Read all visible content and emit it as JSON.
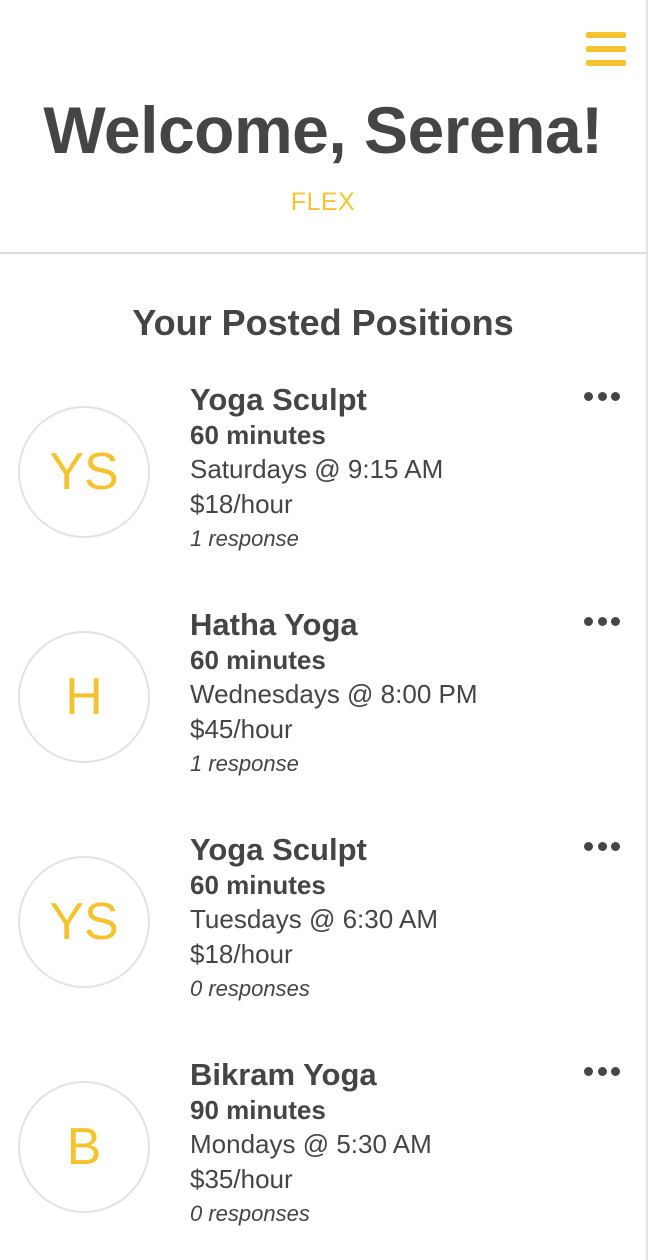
{
  "header": {
    "welcome": "Welcome, Serena!",
    "brand": "FLEX",
    "menu_icon": "hamburger-menu-icon"
  },
  "main": {
    "section_title": "Your Posted Positions",
    "positions": [
      {
        "initials": "YS",
        "title": "Yoga Sculpt",
        "duration": "60 minutes",
        "schedule": "Saturdays @ 9:15 AM",
        "rate": "$18/hour",
        "responses": "1 response"
      },
      {
        "initials": "H",
        "title": "Hatha Yoga",
        "duration": "60 minutes",
        "schedule": "Wednesdays @ 8:00 PM",
        "rate": "$45/hour",
        "responses": "1 response"
      },
      {
        "initials": "YS",
        "title": "Yoga Sculpt",
        "duration": "60 minutes",
        "schedule": "Tuesdays @ 6:30 AM",
        "rate": "$18/hour",
        "responses": "0 responses"
      },
      {
        "initials": "B",
        "title": "Bikram Yoga",
        "duration": "90 minutes",
        "schedule": "Mondays @ 5:30 AM",
        "rate": "$35/hour",
        "responses": "0 responses"
      }
    ]
  },
  "colors": {
    "accent": "#f4c430",
    "text": "#454545",
    "divider": "#dcdcdc",
    "avatar_border": "#e2e2e2"
  }
}
